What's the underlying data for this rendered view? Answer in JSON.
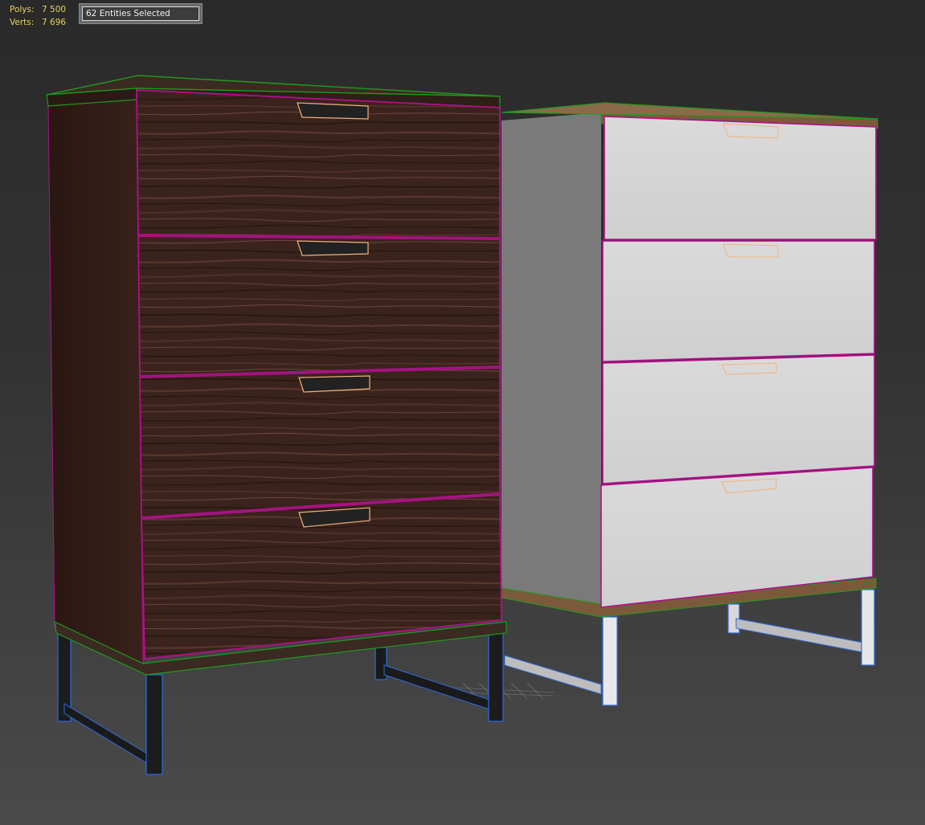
{
  "stats": {
    "polys_label": "Polys:",
    "polys_value": "7 500",
    "verts_label": "Verts:",
    "verts_value": "7 696"
  },
  "selection": {
    "text": "62 Entities Selected"
  },
  "colors": {
    "stats_text": "#e8d25a",
    "selection_outline_magenta": "#b0108a",
    "edge_green": "#1f9b1f",
    "edge_blue": "#2f6bdc",
    "handle_outline": "#f2b27a",
    "wood_dark": "#3a221c",
    "white_panel": "#d4d4d4"
  },
  "scene": {
    "objects": [
      "dark-wood-dresser",
      "white-dresser"
    ],
    "drawer_count_each": 4
  }
}
